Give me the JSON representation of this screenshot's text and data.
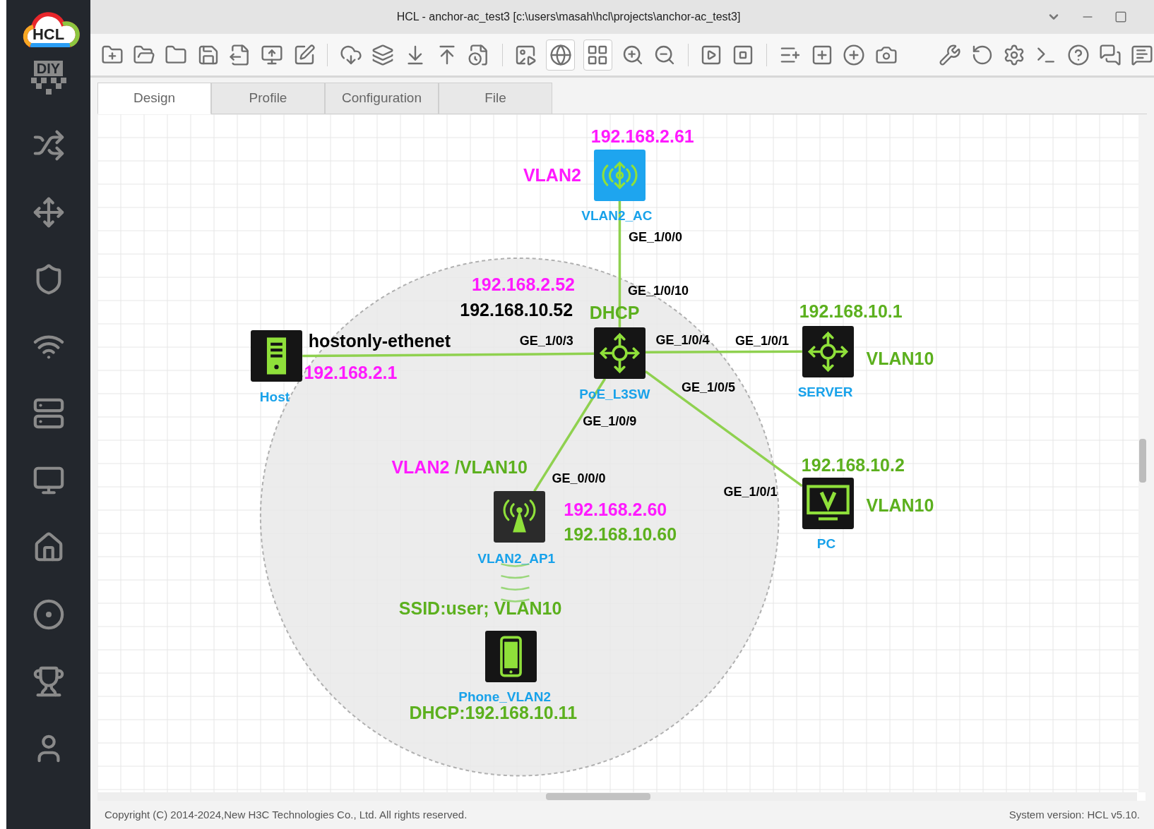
{
  "window": {
    "title": "HCL - anchor-ac_test3 [c:\\users\\masah\\hcl\\projects\\anchor-ac_test3]"
  },
  "logo": {
    "text": "HCL"
  },
  "sidebar": {
    "diy_label": "DIY"
  },
  "tabs": [
    {
      "label": "Design",
      "selected": true
    },
    {
      "label": "Profile",
      "selected": false
    },
    {
      "label": "Configuration",
      "selected": false
    },
    {
      "label": "File",
      "selected": false
    }
  ],
  "nodes": [
    {
      "name": "VLAN2_AC",
      "kind": "ac"
    },
    {
      "name": "Host",
      "kind": "host"
    },
    {
      "name": "PoE_L3SW",
      "kind": "switch"
    },
    {
      "name": "SERVER",
      "kind": "switch"
    },
    {
      "name": "PC",
      "kind": "pc"
    },
    {
      "name": "VLAN2_AP1",
      "kind": "ap"
    },
    {
      "name": "Phone_VLAN2",
      "kind": "phone"
    }
  ],
  "labels": [
    {
      "text": "192.168.2.61",
      "color": "#ff1aff"
    },
    {
      "text": "VLAN2",
      "color": "#ff1aff"
    },
    {
      "text": "GE_1/0/0",
      "color": "#000000"
    },
    {
      "text": "192.168.2.52",
      "color": "#ff1aff"
    },
    {
      "text": "GE_1/0/10",
      "color": "#000000"
    },
    {
      "text": "192.168.10.52",
      "color": "#000000"
    },
    {
      "text": "DHCP",
      "color": "#5cb01e"
    },
    {
      "text": "192.168.10.1",
      "color": "#5cb01e"
    },
    {
      "text": "hostonly-ethenet",
      "color": "#000000"
    },
    {
      "text": "GE_1/0/3",
      "color": "#000000"
    },
    {
      "text": "GE_1/0/4",
      "color": "#000000"
    },
    {
      "text": "GE_1/0/1",
      "color": "#000000"
    },
    {
      "text": "VLAN10",
      "color": "#5cb01e"
    },
    {
      "text": "192.168.2.1",
      "color": "#ff1aff"
    },
    {
      "text": "GE_1/0/5",
      "color": "#000000"
    },
    {
      "text": "GE_1/0/9",
      "color": "#000000"
    },
    {
      "text": "VLAN2",
      "color": "#ff1aff"
    },
    {
      "text": "/VLAN10",
      "color": "#5cb01e"
    },
    {
      "text": "192.168.10.2",
      "color": "#5cb01e"
    },
    {
      "text": "GE_0/0/0",
      "color": "#000000"
    },
    {
      "text": "GE_1/0/1",
      "color": "#000000"
    },
    {
      "text": "VLAN10",
      "color": "#5cb01e"
    },
    {
      "text": "192.168.2.60",
      "color": "#ff1aff"
    },
    {
      "text": "192.168.10.60",
      "color": "#5cb01e"
    },
    {
      "text": "SSID:user; VLAN10",
      "color": "#5cb01e"
    },
    {
      "text": "DHCP:192.168.10.11",
      "color": "#5cb01e"
    }
  ],
  "status_bar": {
    "copyright": "Copyright (C) 2014-2024,New H3C Technologies Co., Ltd. All rights reserved.",
    "version": "System version: HCL v5.10."
  }
}
